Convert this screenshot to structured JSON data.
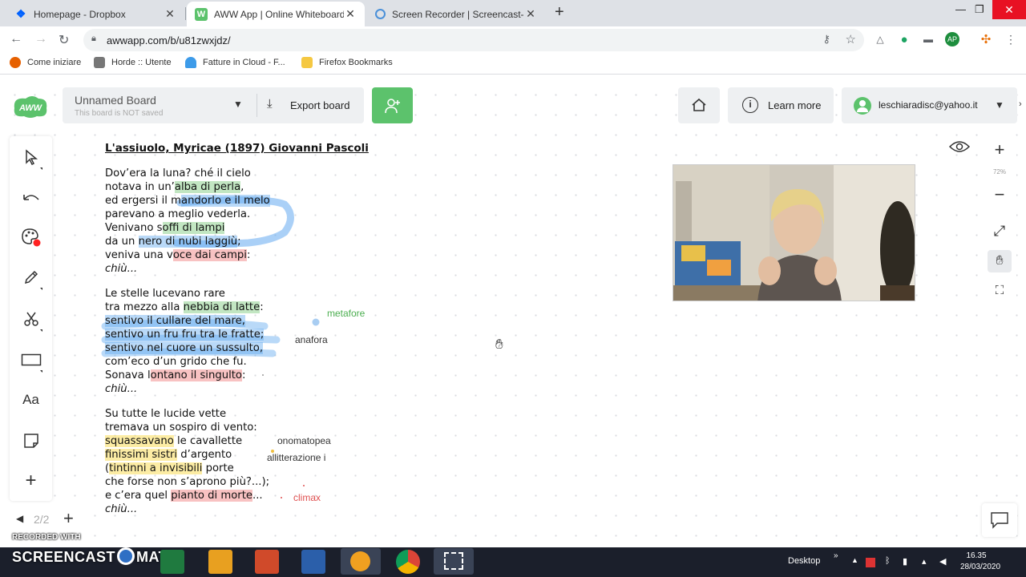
{
  "browser": {
    "tabs": [
      {
        "title": "Homepage - Dropbox",
        "active": false
      },
      {
        "title": "AWW App | Online Whiteboard f",
        "active": true
      },
      {
        "title": "Screen Recorder | Screencast-O-",
        "active": false
      }
    ],
    "url": "awwapp.com/b/u81zwxjdz/",
    "bookmarks": [
      "Come iniziare",
      "Horde :: Utente",
      "Fatture in Cloud - F...",
      "Firefox Bookmarks"
    ]
  },
  "app": {
    "board_title": "Unnamed Board",
    "board_subtitle": "This board is NOT saved",
    "export_label": "Export board",
    "learn_more_label": "Learn more",
    "user_email": "leschiaradisc@yahoo.it",
    "zoom_level": "72%",
    "page_indicator": "2/2",
    "text_tool_label": "Aa"
  },
  "poem": {
    "title": "L'assiuolo, Myricae (1897) Giovanni Pascoli",
    "stanza1": [
      "Dov’era la luna? ché il cielo",
      "notava in un’alba di perla,",
      "ed ergersi il mandorlo e il melo",
      "parevano a meglio vederla.",
      "Venivano soffi di lampi",
      "da un nero di nubi laggiù;",
      "veniva una voce dai campi:",
      "chiù..."
    ],
    "stanza2": [
      "Le stelle lucevano rare",
      "tra mezzo alla nebbia di latte:",
      "sentivo il cullare del mare,",
      "sentivo un fru fru tra le fratte;",
      "sentivo nel cuore un sussulto,",
      "com’eco d’un grido che fu.",
      "Sonava lontano il singulto:",
      "chiù..."
    ],
    "stanza3": [
      "Su tutte le lucide vette",
      "tremava un sospiro di vento:",
      "squassavano le cavallette",
      "finissimi sistri d’argento",
      "(tintinni a invisibili porte",
      "che forse non s’aprono più?...);",
      "e c’era quel pianto di morte...",
      "chiù..."
    ]
  },
  "annotations": {
    "metafore": "metafore",
    "anafora": "anafora",
    "onomatopea": "onomatopea",
    "allitterazione": "allitterazione i",
    "climax": "climax"
  },
  "overlay": {
    "recorded_with": "RECORDED WITH",
    "brand": "SCREENCAST",
    "brand_tail": "MATIC"
  },
  "taskbar": {
    "desktop_label": "Desktop",
    "time": "16.35",
    "date": "28/03/2020"
  },
  "colors": {
    "brand_green": "#5cc26c",
    "highlight_green": "#78c878",
    "highlight_blue": "#64aaf0",
    "highlight_red": "#f07878",
    "highlight_yellow": "#fadc5a"
  }
}
